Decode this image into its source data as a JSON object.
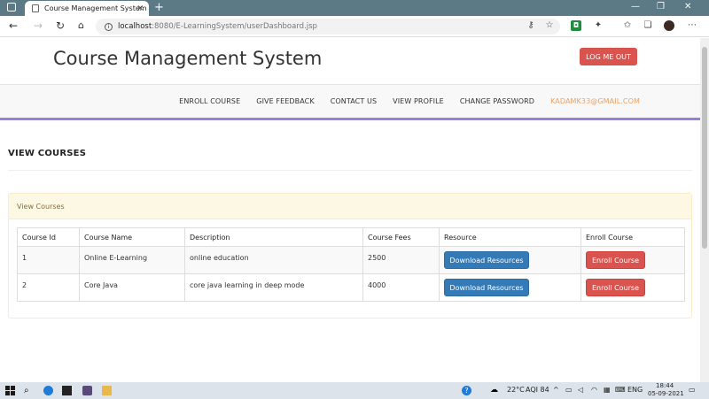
{
  "browser": {
    "tab_title": "Course Management System",
    "url_host": "localhost",
    "url_path": ":8080/E-LearningSystem/userDashboard.jsp"
  },
  "header": {
    "brand": "Course Management System",
    "logout_label": "LOG ME OUT"
  },
  "nav": {
    "items": [
      "ENROLL COURSE",
      "GIVE FEEDBACK",
      "CONTACT US",
      "VIEW PROFILE",
      "CHANGE PASSWORD"
    ],
    "email": "KADAMK33@GMAIL.COM"
  },
  "main": {
    "title": "VIEW COURSES",
    "panel_title": "View Courses",
    "columns": [
      "Course Id",
      "Course Name",
      "Description",
      "Course Fees",
      "Resource",
      "Enroll Course"
    ],
    "rows": [
      {
        "id": "1",
        "name": "Online E-Learning",
        "description": "online education",
        "fees": "2500",
        "resource_label": "Download Resources",
        "enroll_label": "Enroll Course"
      },
      {
        "id": "2",
        "name": "Core Java",
        "description": "core java learning in deep mode",
        "fees": "4000",
        "resource_label": "Download Resources",
        "enroll_label": "Enroll Course"
      }
    ]
  },
  "taskbar": {
    "temperature": "22°C",
    "aqi": "AQI 84",
    "language": "ENG",
    "time": "18:44",
    "date": "05-09-2021"
  },
  "colors": {
    "danger": "#d9534f",
    "primary": "#337ab7",
    "nav_accent": "#9b7fd6",
    "email": "#f0a060"
  }
}
